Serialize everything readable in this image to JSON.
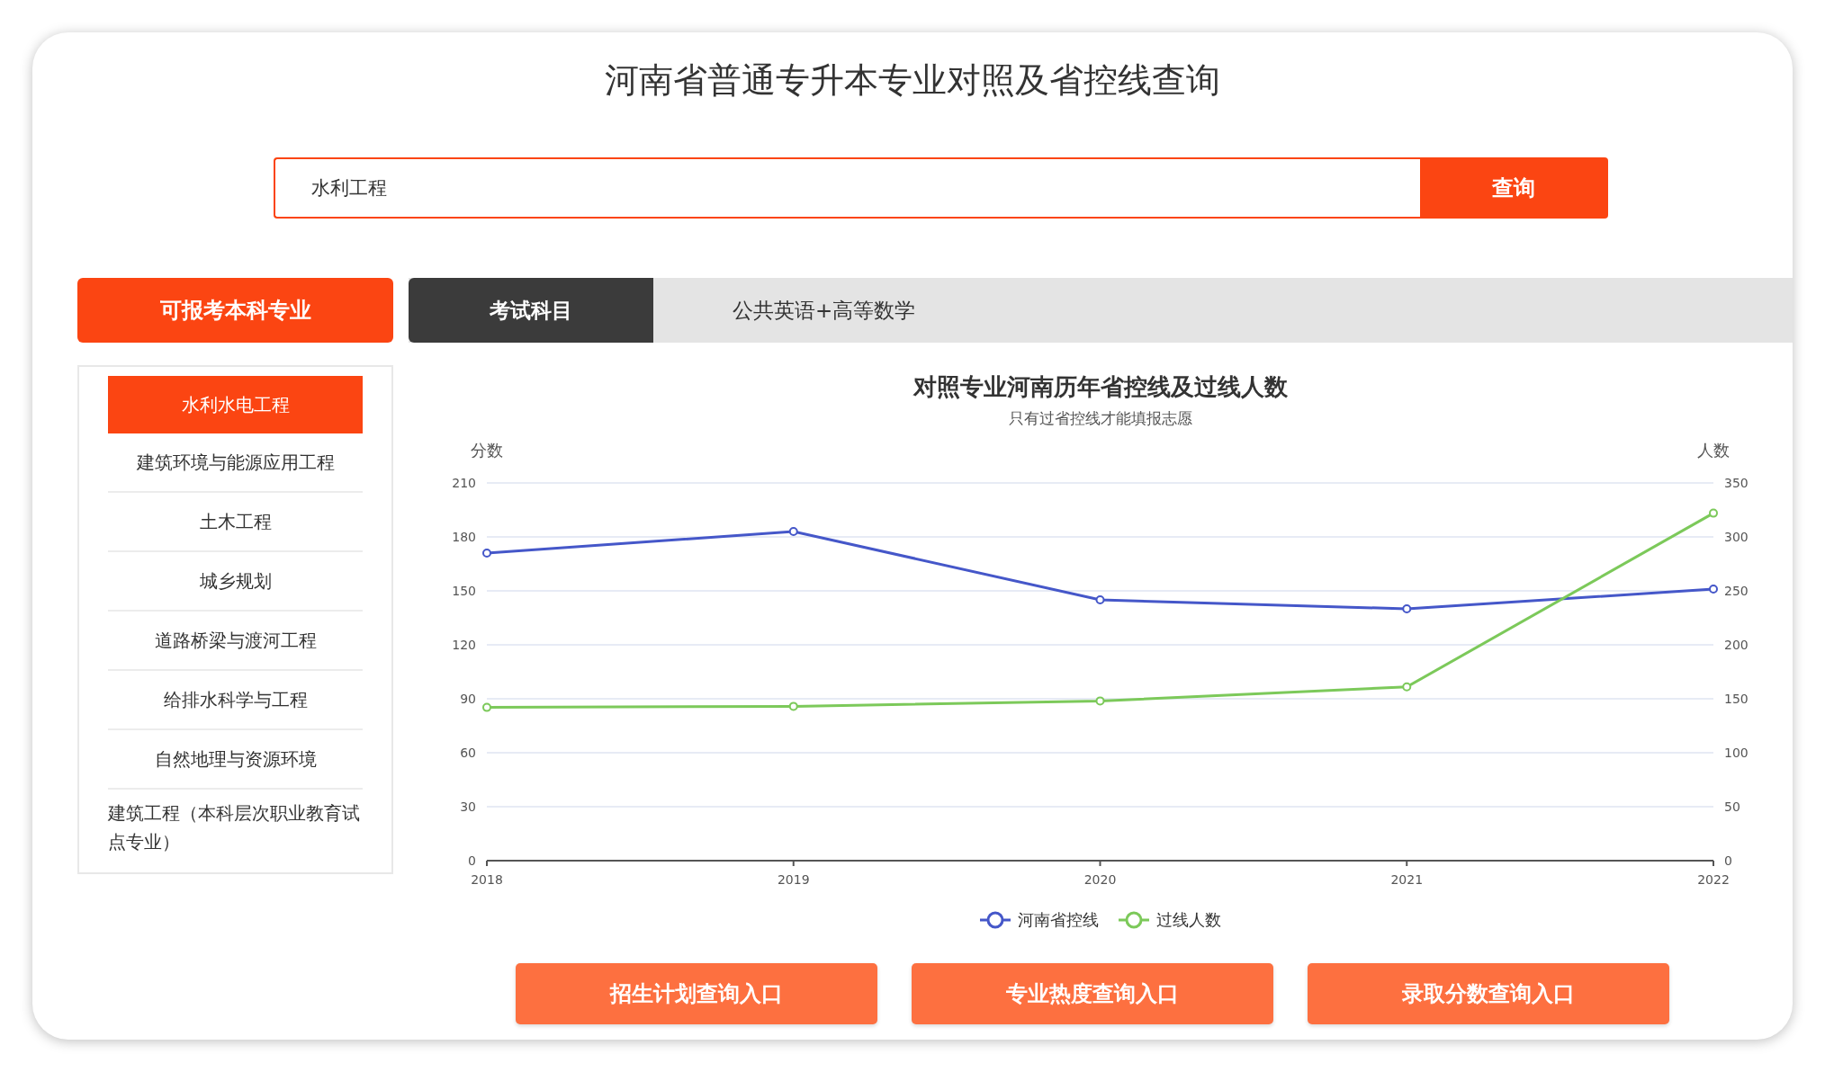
{
  "title": "河南省普通专升本专业对照及省控线查询",
  "search": {
    "value": "水利工程",
    "button": "查询"
  },
  "tabs": {
    "left_tab": "可报考本科专业",
    "subject_tab": "考试科目",
    "subjects": "公共英语+高等数学"
  },
  "majors": [
    {
      "label": "水利水电工程",
      "selected": true
    },
    {
      "label": "建筑环境与能源应用工程",
      "selected": false
    },
    {
      "label": "土木工程",
      "selected": false
    },
    {
      "label": "城乡规划",
      "selected": false
    },
    {
      "label": "道路桥梁与渡河工程",
      "selected": false
    },
    {
      "label": "给排水科学与工程",
      "selected": false
    },
    {
      "label": "自然地理与资源环境",
      "selected": false
    },
    {
      "label": "建筑工程（本科层次职业教育试点专业）",
      "selected": false
    }
  ],
  "chart": {
    "subtitle": "只有过省控线才能填报志愿",
    "chart_data": {
      "type": "line",
      "title": "对照专业河南历年省控线及过线人数",
      "ylabel": "分数",
      "categories": [
        "2018",
        "2019",
        "2020",
        "2021",
        "2022"
      ],
      "ylim": [
        0,
        210
      ],
      "yticks": [
        0,
        30,
        60,
        90,
        120,
        150,
        180,
        210
      ],
      "grid": true,
      "legend": true,
      "series": [
        {
          "name": "河南省控线",
          "color": "#4557c9",
          "marker": "circle",
          "values": [
            171,
            183,
            145,
            140,
            151
          ]
        }
      ]
    },
    "right_axis": {
      "chart_data": {
        "type": "line",
        "ylabel": "人数",
        "ylim": [
          0,
          350
        ],
        "yticks": [
          0,
          50,
          100,
          150,
          200,
          250,
          300,
          350
        ],
        "series": [
          {
            "name": "过线人数",
            "color": "#7cc95a",
            "marker": "circle",
            "values": [
              142,
              143,
              148,
              161,
              322
            ]
          }
        ]
      }
    }
  },
  "links": [
    "招生计划查询入口",
    "专业热度查询入口",
    "录取分数查询入口"
  ]
}
